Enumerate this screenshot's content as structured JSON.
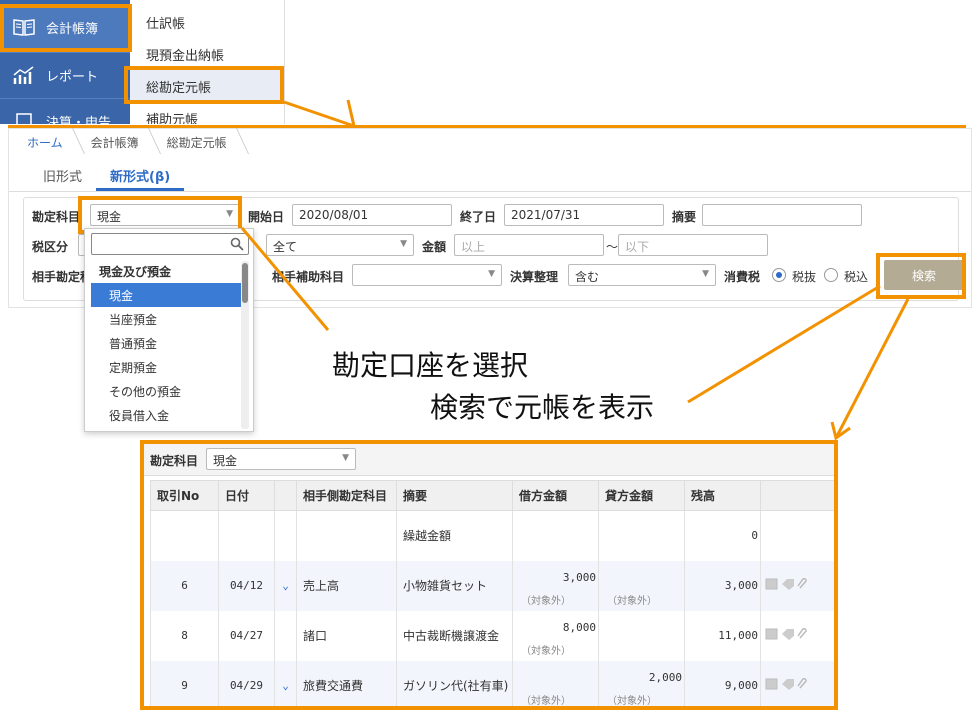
{
  "sidebar": {
    "items": [
      {
        "label": "会計帳簿",
        "icon": "book-icon"
      },
      {
        "label": "レポート",
        "icon": "chart-icon"
      },
      {
        "label": "決算・申告",
        "icon": "document-icon"
      }
    ]
  },
  "submenu": {
    "items": [
      "仕訳帳",
      "現預金出納帳",
      "総勘定元帳",
      "補助元帳"
    ]
  },
  "breadcrumb": [
    "ホーム",
    "会計帳簿",
    "総勘定元帳"
  ],
  "tabs": [
    "旧形式",
    "新形式(β)"
  ],
  "filter": {
    "account_label": "勘定科目",
    "account_value": "現金",
    "start_label": "開始日",
    "start_value": "2020/08/01",
    "end_label": "終了日",
    "end_value": "2021/07/31",
    "memo_label": "摘要",
    "memo_value": "",
    "taxclass_label": "税区分",
    "taxclass_value": "全",
    "sub_all": "全て",
    "amount_label": "金額",
    "amount_min_ph": "以上",
    "amount_tilde": "〜",
    "amount_max_ph": "以下",
    "counter_label": "相手勘定科",
    "counter_sub_label": "相手補助科目",
    "counter_sub_value": "",
    "closing_label": "決算整理",
    "closing_value": "含む",
    "tax_label": "消費税",
    "tax_excl": "税抜",
    "tax_incl": "税込",
    "search_button": "検索"
  },
  "dropdown": {
    "group": "現金及び預金",
    "items": [
      "現金",
      "当座預金",
      "普通預金",
      "定期預金",
      "その他の預金",
      "役員借入金"
    ]
  },
  "annotations": {
    "line1": "勘定口座を選択",
    "line2": "検索で元帳を表示"
  },
  "result": {
    "account_label": "勘定科目",
    "account_value": "現金",
    "columns": [
      "取引No",
      "日付",
      "",
      "相手側勘定科目",
      "摘要",
      "借方金額",
      "貸方金額",
      "残高"
    ],
    "tax_note": "（対象外）",
    "rows": [
      {
        "no": "",
        "date": "",
        "counter": "",
        "memo": "繰越金額",
        "debit": "",
        "credit": "",
        "balance": "0"
      },
      {
        "no": "6",
        "date": "04/12",
        "counter": "売上高",
        "memo": "小物雑貨セット",
        "debit": "3,000",
        "credit": "",
        "balance": "3,000"
      },
      {
        "no": "8",
        "date": "04/27",
        "counter": "諸口",
        "memo": "中古裁断機譲渡金",
        "debit": "8,000",
        "credit": "",
        "balance": "11,000"
      },
      {
        "no": "9",
        "date": "04/29",
        "counter": "旅費交通費",
        "memo": "ガソリン代(社有車)",
        "debit": "",
        "credit": "2,000",
        "balance": "9,000"
      }
    ]
  },
  "colors": {
    "accent": "#f39200",
    "sidebar": "#3a65a8",
    "link": "#2e6bc6",
    "button": "#b3ab93"
  }
}
